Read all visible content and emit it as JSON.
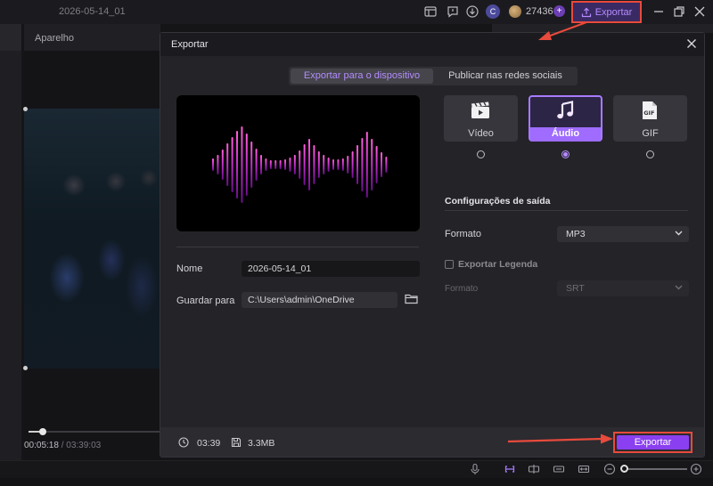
{
  "titlebar": {
    "project_title": "2026-05-14_01",
    "avatar_letter": "C",
    "credits": "27436",
    "plus": "+",
    "export_label": "Exportar"
  },
  "editor": {
    "player_tab": "Aparelho",
    "current_time": "00:05:18",
    "total_time": "/ 03:39:03"
  },
  "dialog": {
    "title": "Exportar",
    "tabs": {
      "device": "Exportar para o dispositivo",
      "social": "Publicar nas redes sociais"
    },
    "name_label": "Nome",
    "name_value": "2026-05-14_01",
    "save_label": "Guardar para",
    "save_path": "C:\\Users\\admin\\OneDrive",
    "formats": [
      {
        "label": "Vídeo",
        "icon": "video-icon",
        "selected": false
      },
      {
        "label": "Áudio",
        "icon": "music-note-icon",
        "selected": true
      },
      {
        "label": "GIF",
        "icon": "gif-icon",
        "selected": false
      }
    ],
    "output_title": "Configurações de saída",
    "format_label": "Formato",
    "format_value": "MP3",
    "subtitle_label": "Exportar Legenda",
    "subtitle_checked": false,
    "subtitle_format_label": "Formato",
    "subtitle_format_value": "SRT",
    "duration": "03:39",
    "file_size": "3.3MB",
    "export_button": "Exportar"
  },
  "colors": {
    "accent": "#9f6cff",
    "accent_text": "#b58cff",
    "annotation_red": "#e84a3c",
    "waveform_top": "#ff5fd8",
    "waveform_bottom": "#6a0f8a"
  }
}
